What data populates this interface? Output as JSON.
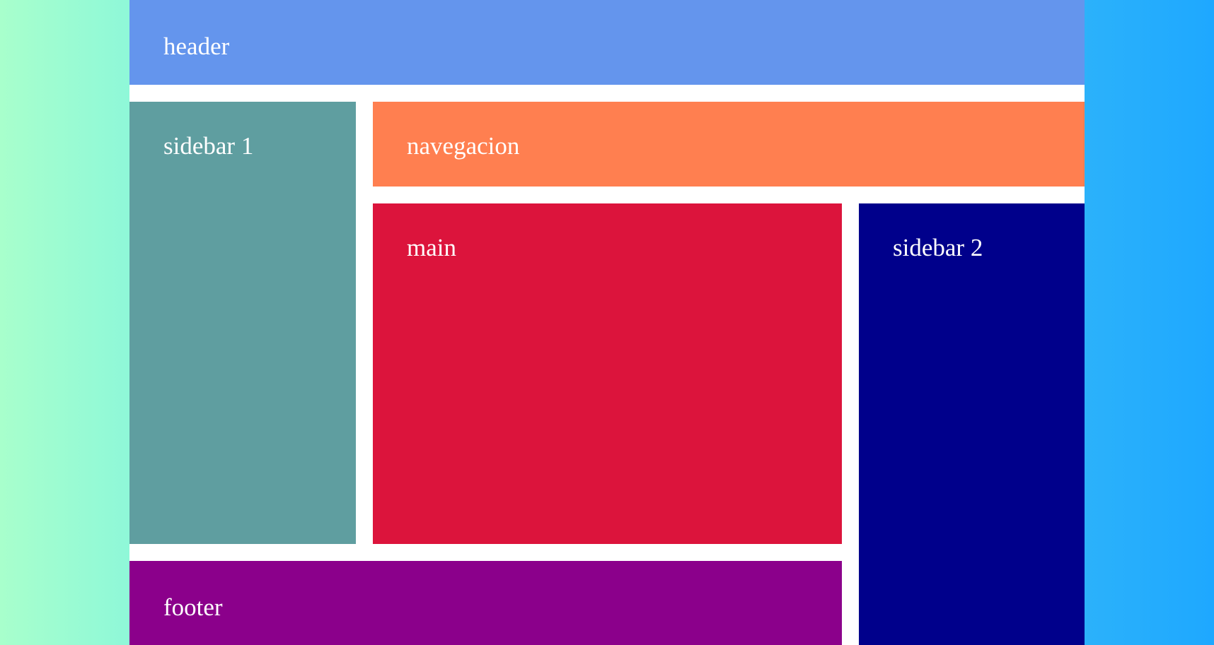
{
  "layout": {
    "header": {
      "label": "header",
      "color": "#6495ed"
    },
    "sidebar1": {
      "label": "sidebar 1",
      "color": "#5f9ea0"
    },
    "navigation": {
      "label": "navegacion",
      "color": "#ff7f50"
    },
    "main": {
      "label": "main",
      "color": "#dc143c"
    },
    "sidebar2": {
      "label": "sidebar 2",
      "color": "#00008b"
    },
    "footer": {
      "label": "footer",
      "color": "#8b008b"
    }
  },
  "background": {
    "gradient_start": "#a8ffcc",
    "gradient_end": "#1ea8ff",
    "frame_color": "#ffffff"
  }
}
